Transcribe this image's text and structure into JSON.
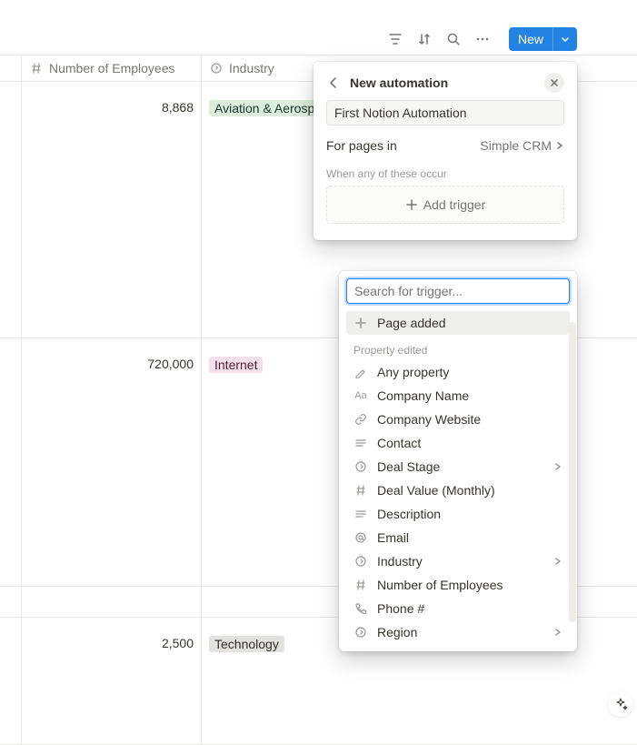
{
  "toolbar": {
    "new_label": "New"
  },
  "table": {
    "header_employees": "Number of Employees",
    "header_industry": "Industry",
    "rows": [
      {
        "employees": "8,868",
        "industry": "Aviation & Aerospace",
        "industry_tag": "green"
      },
      {
        "employees": "720,000",
        "industry": "Internet",
        "industry_tag": "pink"
      },
      {
        "employees": "2,500",
        "industry": "Technology",
        "industry_tag": "gray"
      }
    ]
  },
  "panel": {
    "title": "New automation",
    "name_value": "First Notion Automation",
    "pages_label": "For pages in",
    "pages_value": "Simple CRM",
    "when_label": "When any of these occur",
    "add_trigger": "Add trigger"
  },
  "trigger_popover": {
    "search_placeholder": "Search for trigger...",
    "page_added": "Page added",
    "group_label": "Property edited",
    "props": [
      {
        "label": "Any property",
        "icon": "pencil"
      },
      {
        "label": "Company Name",
        "icon": "text-aa"
      },
      {
        "label": "Company Website",
        "icon": "link"
      },
      {
        "label": "Contact",
        "icon": "lines"
      },
      {
        "label": "Deal Stage",
        "icon": "status",
        "chevron": true
      },
      {
        "label": "Deal Value (Monthly)",
        "icon": "hash"
      },
      {
        "label": "Description",
        "icon": "lines"
      },
      {
        "label": "Email",
        "icon": "at"
      },
      {
        "label": "Industry",
        "icon": "status",
        "chevron": true
      },
      {
        "label": "Number of Employees",
        "icon": "hash"
      },
      {
        "label": "Phone #",
        "icon": "phone"
      },
      {
        "label": "Region",
        "icon": "status",
        "chevron": true
      }
    ]
  }
}
